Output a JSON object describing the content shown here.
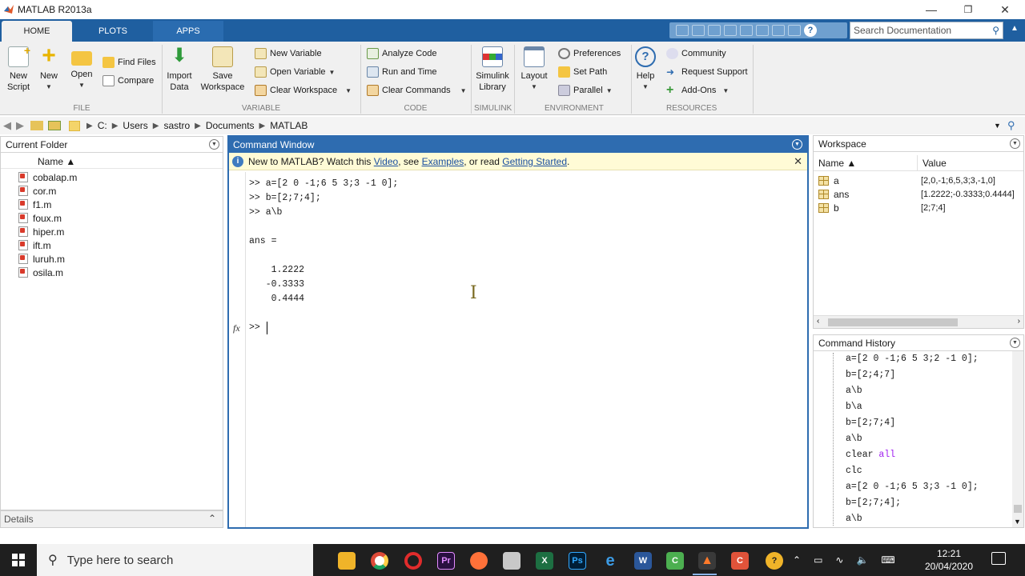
{
  "window": {
    "title": "MATLAB R2013a",
    "minimize": "—",
    "maximize": "❐",
    "close": "✕"
  },
  "tabs": [
    {
      "label": "HOME"
    },
    {
      "label": "PLOTS"
    },
    {
      "label": "APPS"
    }
  ],
  "search_doc": {
    "placeholder": "Search Documentation"
  },
  "ribbon": {
    "new_script": "New\nScript",
    "new": "New",
    "open": "Open",
    "find_files": "Find Files",
    "compare": "Compare",
    "import_data": "Import\nData",
    "save_workspace": "Save\nWorkspace",
    "new_variable": "New Variable",
    "open_variable": "Open Variable",
    "clear_workspace": "Clear Workspace",
    "analyze_code": "Analyze Code",
    "run_and_time": "Run and Time",
    "clear_commands": "Clear Commands",
    "simulink_library": "Simulink\nLibrary",
    "layout": "Layout",
    "preferences": "Preferences",
    "set_path": "Set Path",
    "parallel": "Parallel",
    "help": "Help",
    "community": "Community",
    "request_support": "Request Support",
    "add_ons": "Add-Ons",
    "groups": {
      "file": "FILE",
      "variable": "VARIABLE",
      "code": "CODE",
      "simulink": "SIMULINK",
      "environment": "ENVIRONMENT",
      "resources": "RESOURCES"
    }
  },
  "address": {
    "crumbs": [
      "C:",
      "Users",
      "sastro",
      "Documents",
      "MATLAB"
    ]
  },
  "current_folder": {
    "title": "Current Folder",
    "column": "Name ▲",
    "files": [
      "cobalap.m",
      "cor.m",
      "f1.m",
      "foux.m",
      "hiper.m",
      "ift.m",
      "luruh.m",
      "osila.m"
    ],
    "details": "Details"
  },
  "command_window": {
    "title": "Command Window",
    "info": {
      "prefix": "New to MATLAB? Watch this ",
      "video": "Video",
      "sep1": ", see ",
      "examples": "Examples",
      "sep2": ", or read ",
      "getting_started": "Getting Started",
      "suffix": "."
    },
    "lines": [
      ">> a=[2 0 -1;6 5 3;3 -1 0];",
      ">> b=[2;7;4];",
      ">> a\\b",
      "",
      "ans =",
      "",
      "    1.2222",
      "   -0.3333",
      "    0.4444"
    ],
    "prompt": ">> ",
    "fx": "fx"
  },
  "workspace": {
    "title": "Workspace",
    "columns": [
      "Name ▲",
      "Value"
    ],
    "rows": [
      {
        "name": "a",
        "value": "[2,0,-1;6,5,3;3,-1,0]"
      },
      {
        "name": "ans",
        "value": "[1.2222;-0.3333;0.4444]"
      },
      {
        "name": "b",
        "value": "[2;7;4]"
      }
    ]
  },
  "history": {
    "title": "Command History",
    "lines": [
      "a=[2 0 -1;6 5 3;2 -1 0];",
      "b=[2;4;7]",
      "a\\b",
      "b\\a",
      "b=[2;7;4]",
      "a\\b",
      "clear ",
      "clc",
      "a=[2 0 -1;6 5 3;3 -1 0];",
      "b=[2;7;4];",
      "a\\b"
    ],
    "keyword": "all"
  },
  "taskbar": {
    "search_placeholder": "Type here to search",
    "time": "12:21",
    "date": "20/04/2020"
  }
}
